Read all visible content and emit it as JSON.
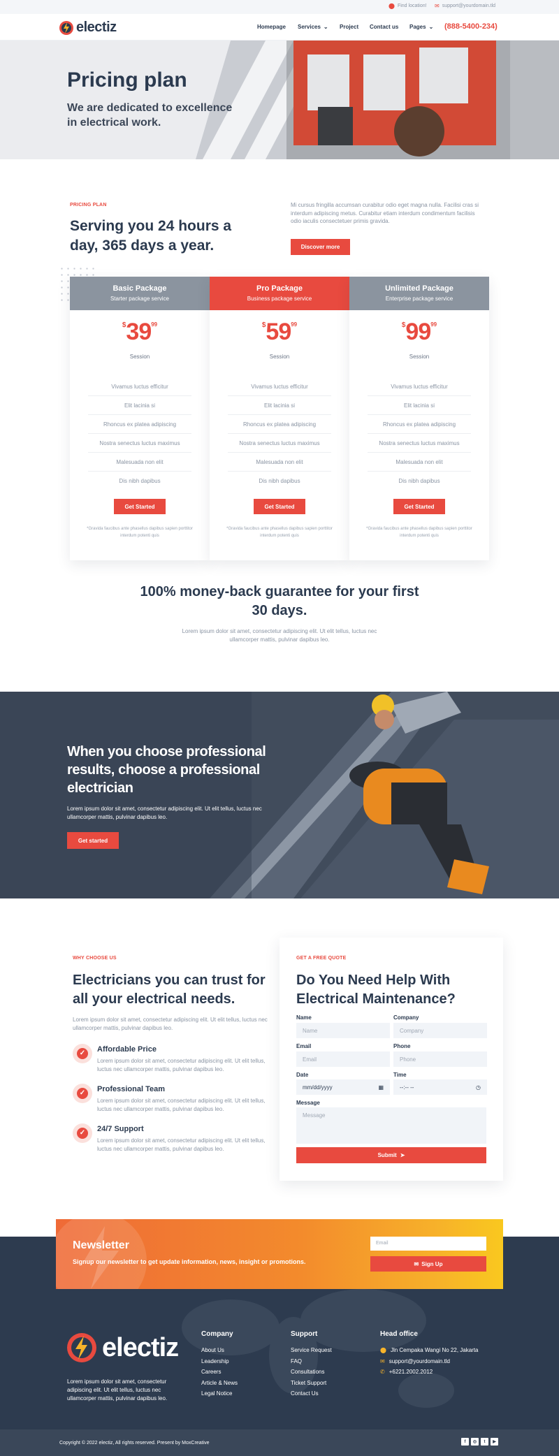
{
  "topbar": {
    "location": "Find location!",
    "email": "support@yourdomain.tld"
  },
  "nav": {
    "logo": "electiz",
    "links": [
      "Homepage",
      "Services",
      "Project",
      "Contact us",
      "Pages"
    ],
    "phone": "(888-5400-234)"
  },
  "hero": {
    "title": "Pricing plan",
    "subtitle": "We are dedicated to excellence in electrical work."
  },
  "pricing": {
    "eyebrow": "PRICING PLAN",
    "heading": "Serving you 24 hours a day, 365 days a year.",
    "text": "Mi cursus fringilla accumsan curabitur odio eget magna nulla. Facilisi cras si interdum adipiscing metus. Curabitur etiam interdum condimentum facilisis odio iaculis consectetuer primis gravida.",
    "button": "Discover more",
    "plans": [
      {
        "name": "Basic Package",
        "tag": "Starter package service",
        "currency": "$",
        "price": "39",
        "cents": "99",
        "unit": "Session"
      },
      {
        "name": "Pro Package",
        "tag": "Business package service",
        "currency": "$",
        "price": "59",
        "cents": "99",
        "unit": "Session"
      },
      {
        "name": "Unlimited Package",
        "tag": "Enterprise package service",
        "currency": "$",
        "price": "99",
        "cents": "99",
        "unit": "Session"
      }
    ],
    "features": [
      "Vivamus luctus efficitur",
      "Elit lacinia si",
      "Rhoncus ex platea adipiscing",
      "Nostra senectus luctus maximus",
      "Malesuada non elit",
      "Dis nibh dapibus"
    ],
    "card_button": "Get Started",
    "card_note": "*Gravida faucibus ante phasellus dapibus sapien porttitor interdum potenti quis",
    "guarantee": "100% money-back guarantee for your first 30 days.",
    "guarantee_text": "Lorem ipsum dolor sit amet, consectetur adipiscing elit. Ut elit tellus, luctus nec ullamcorper mattis, pulvinar dapibus leo."
  },
  "banner": {
    "title": "When you choose professional results, choose a professional electrician",
    "text": "Lorem ipsum dolor sit amet, consectetur adipiscing elit. Ut elit tellus, luctus nec ullamcorper mattis, pulvinar dapibus leo.",
    "button": "Get started"
  },
  "why": {
    "eyebrow": "WHY CHOOSE US",
    "heading": "Electricians you can trust for all your electrical needs.",
    "text": "Lorem ipsum dolor sit amet, consectetur adipiscing elit. Ut elit tellus, luctus nec ullamcorper mattis, pulvinar dapibus leo.",
    "items": [
      {
        "title": "Affordable Price",
        "text": "Lorem ipsum dolor sit amet, consectetur adipiscing elit. Ut elit tellus, luctus nec ullamcorper mattis, pulvinar dapibus leo."
      },
      {
        "title": "Professional Team",
        "text": "Lorem ipsum dolor sit amet, consectetur adipiscing elit. Ut elit tellus, luctus nec ullamcorper mattis, pulvinar dapibus leo."
      },
      {
        "title": "24/7 Support",
        "text": "Lorem ipsum dolor sit amet, consectetur adipiscing elit. Ut elit tellus, luctus nec ullamcorper mattis, pulvinar dapibus leo."
      }
    ]
  },
  "quote": {
    "eyebrow": "GET A FREE QUOTE",
    "heading": "Do You Need Help With Electrical Maintenance?",
    "fields": {
      "name": {
        "label": "Name",
        "placeholder": "Name"
      },
      "company": {
        "label": "Company",
        "placeholder": "Company"
      },
      "email": {
        "label": "Email",
        "placeholder": "Email"
      },
      "phone": {
        "label": "Phone",
        "placeholder": "Phone"
      },
      "date": {
        "label": "Date",
        "placeholder": "mm/dd/yyyy"
      },
      "time": {
        "label": "Time",
        "placeholder": "--:-- --"
      },
      "message": {
        "label": "Message",
        "placeholder": "Message"
      }
    },
    "submit": "Submit"
  },
  "newsletter": {
    "title": "Newsletter",
    "subtitle": "Signup our newsletter to get update information, news, insight or promotions.",
    "placeholder": "Email",
    "button": "Sign Up"
  },
  "footer": {
    "logo": "electiz",
    "description": "Lorem ipsum dolor sit amet, consectetur adipiscing elit. Ut elit tellus, luctus nec ullamcorper mattis, pulvinar dapibus leo.",
    "company": {
      "heading": "Company",
      "links": [
        "About Us",
        "Leadership",
        "Careers",
        "Article & News",
        "Legal Notice"
      ]
    },
    "support": {
      "heading": "Support",
      "links": [
        "Service Request",
        "FAQ",
        "Consultations",
        "Ticket Support",
        "Contact Us"
      ]
    },
    "office": {
      "heading": "Head office",
      "address": "Jln Cempaka Wangi No 22, Jakarta",
      "email": "support@yourdomain.tld",
      "phone": "+6221.2002.2012"
    },
    "copyright": "Copyright © 2022 electiz, All rights reserved. Present by MoxCreative",
    "social": [
      "f",
      "◎",
      "t",
      "▶"
    ]
  },
  "colors": {
    "accent": "#e84a3f",
    "dark": "#2d3b4f",
    "gray": "#8b949f"
  }
}
